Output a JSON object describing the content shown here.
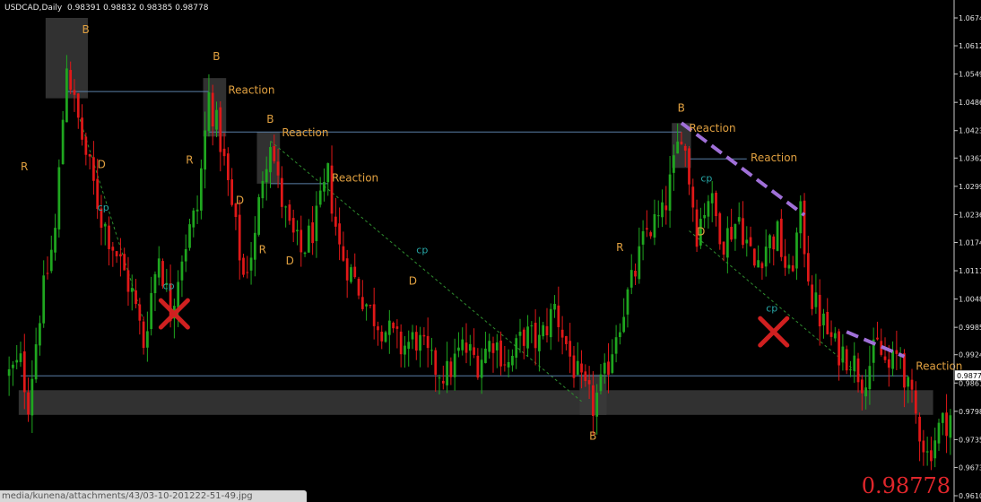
{
  "header": {
    "symbol": "USDCAD,Daily",
    "ohlc": "0.98391 0.98832 0.98385 0.98778"
  },
  "big_price": "0.98778",
  "status_url": "media/kunena/attachments/43/03-10-201222-51-49.jpg",
  "colors": {
    "background": "#000000",
    "bull": "#1fa61f",
    "bear": "#e01818",
    "annotation": "#e0a040",
    "cp_label": "#27a6a6",
    "level_line": "#5a7fa8",
    "zone": "#3a3a3a",
    "trendline": "#a070d8",
    "guide": "#2f8f2f",
    "cross": "#d02020",
    "big_price": "#e0262b"
  },
  "chart_data": {
    "type": "candlestick",
    "symbol": "USDCAD",
    "timeframe": "Daily",
    "ylim": [
      0.961,
      1.0674
    ],
    "y_tick_labels": [
      "1.0674",
      "1.0612",
      "1.0549",
      "1.0486",
      "1.0423",
      "1.0362",
      "1.0299",
      "1.0236",
      "1.0174",
      "1.0111",
      "1.0048",
      "0.9985",
      "0.9924",
      "0.9861",
      "0.9798",
      "0.9735",
      "0.9673",
      "0.9610"
    ],
    "last_price_label": "0.9877",
    "price_path": [
      [
        0,
        0.988
      ],
      [
        3,
        0.9905
      ],
      [
        5,
        0.982
      ],
      [
        8,
        1.002
      ],
      [
        12,
        1.02
      ],
      [
        15,
        1.058
      ],
      [
        17,
        1.048
      ],
      [
        20,
        1.037
      ],
      [
        24,
        1.023
      ],
      [
        28,
        1.015
      ],
      [
        32,
        1.006
      ],
      [
        35,
        0.995
      ],
      [
        37,
        1.006
      ],
      [
        39,
        1.015
      ],
      [
        42,
        1.002
      ],
      [
        45,
        1.015
      ],
      [
        49,
        1.025
      ],
      [
        52,
        1.05
      ],
      [
        55,
        1.04
      ],
      [
        58,
        1.025
      ],
      [
        61,
        1.01
      ],
      [
        64,
        1.018
      ],
      [
        66,
        1.033
      ],
      [
        68,
        1.041
      ],
      [
        70,
        1.03
      ],
      [
        73,
        1.02
      ],
      [
        76,
        1.015
      ],
      [
        80,
        1.022
      ],
      [
        83,
        1.032
      ],
      [
        86,
        1.016
      ],
      [
        90,
        1.009
      ],
      [
        94,
        1.002
      ],
      [
        98,
        0.998
      ],
      [
        102,
        0.994
      ],
      [
        106,
        0.996
      ],
      [
        110,
        0.99
      ],
      [
        114,
        0.988
      ],
      [
        118,
        0.994
      ],
      [
        122,
        0.991
      ],
      [
        126,
        0.996
      ],
      [
        130,
        0.99
      ],
      [
        134,
        0.997
      ],
      [
        138,
        0.995
      ],
      [
        142,
        1.003
      ],
      [
        146,
        0.992
      ],
      [
        149,
        0.985
      ],
      [
        152,
        0.981
      ],
      [
        155,
        0.987
      ],
      [
        158,
        0.998
      ],
      [
        162,
        1.008
      ],
      [
        166,
        1.02
      ],
      [
        170,
        1.023
      ],
      [
        173,
        1.034
      ],
      [
        175,
        1.043
      ],
      [
        177,
        1.032
      ],
      [
        179,
        1.02
      ],
      [
        182,
        1.028
      ],
      [
        186,
        1.018
      ],
      [
        190,
        1.023
      ],
      [
        194,
        1.012
      ],
      [
        197,
        1.017
      ],
      [
        200,
        1.019
      ],
      [
        203,
        1.009
      ],
      [
        206,
        1.023
      ],
      [
        209,
        1.005
      ],
      [
        212,
        0.999
      ],
      [
        215,
        0.994
      ],
      [
        219,
        0.992
      ],
      [
        222,
        0.987
      ],
      [
        226,
        0.994
      ],
      [
        229,
        0.989
      ],
      [
        232,
        0.993
      ],
      [
        234,
        0.984
      ],
      [
        237,
        0.976
      ],
      [
        239,
        0.97
      ],
      [
        242,
        0.976
      ],
      [
        245,
        0.979
      ]
    ],
    "levels": [
      {
        "from": 15,
        "to": 52,
        "price": 1.051
      },
      {
        "from": 52,
        "to": 175,
        "price": 1.042
      },
      {
        "from": 68,
        "to": 83,
        "price": 1.0305
      },
      {
        "from": 177,
        "to": 192,
        "price": 1.036
      },
      {
        "from": 155,
        "to": 234,
        "price": 0.9877
      },
      {
        "from": 3,
        "to": 155,
        "price": 0.9877
      }
    ],
    "zones": [
      {
        "from": 10,
        "to": 20,
        "high": 1.0674,
        "low": 1.0495
      },
      {
        "from": 51,
        "to": 56,
        "high": 1.054,
        "low": 1.041
      },
      {
        "from": 65,
        "to": 70,
        "high": 1.042,
        "low": 1.0305
      },
      {
        "from": 173,
        "to": 177,
        "high": 1.044,
        "low": 1.034
      },
      {
        "from": 149,
        "to": 155,
        "high": 0.988,
        "low": 0.979
      },
      {
        "from": 3,
        "to": 240,
        "high": 0.9845,
        "low": 0.979
      }
    ],
    "trendlines": [
      {
        "from": [
          175,
          1.044
        ],
        "to": [
          207,
          1.0235
        ]
      },
      {
        "from": [
          218,
          0.9975
        ],
        "to": [
          233,
          0.992
        ]
      }
    ],
    "guides": [
      {
        "from": [
          18,
          1.046
        ],
        "to": [
          35,
          1.0
        ]
      },
      {
        "from": [
          68,
          1.04
        ],
        "to": [
          149,
          0.982
        ]
      },
      {
        "from": [
          177,
          1.02
        ],
        "to": [
          222,
          0.9875
        ]
      }
    ],
    "annotations": [
      {
        "text": "B",
        "x": 19,
        "price": 1.064,
        "kind": "label"
      },
      {
        "text": "R",
        "x": 3,
        "price": 1.0335,
        "kind": "label"
      },
      {
        "text": "D",
        "x": 23,
        "price": 1.034,
        "kind": "label"
      },
      {
        "text": "cp",
        "x": 23,
        "price": 1.0245,
        "kind": "cp"
      },
      {
        "text": "cp",
        "x": 40,
        "price": 1.007,
        "kind": "cp"
      },
      {
        "text": "B",
        "x": 53,
        "price": 1.058,
        "kind": "label"
      },
      {
        "text": "Reaction",
        "x": 57,
        "price": 1.0505,
        "kind": "label"
      },
      {
        "text": "R",
        "x": 46,
        "price": 1.035,
        "kind": "label"
      },
      {
        "text": "D",
        "x": 59,
        "price": 1.026,
        "kind": "label"
      },
      {
        "text": "R",
        "x": 65,
        "price": 1.015,
        "kind": "label"
      },
      {
        "text": "B",
        "x": 67,
        "price": 1.044,
        "kind": "label"
      },
      {
        "text": "Reaction",
        "x": 71,
        "price": 1.041,
        "kind": "label"
      },
      {
        "text": "D",
        "x": 72,
        "price": 1.0125,
        "kind": "label"
      },
      {
        "text": "Reaction",
        "x": 84,
        "price": 1.031,
        "kind": "label"
      },
      {
        "text": "cp",
        "x": 106,
        "price": 1.015,
        "kind": "cp"
      },
      {
        "text": "D",
        "x": 104,
        "price": 1.008,
        "kind": "label"
      },
      {
        "text": "B",
        "x": 151,
        "price": 0.9735,
        "kind": "label"
      },
      {
        "text": "R",
        "x": 158,
        "price": 1.0155,
        "kind": "label"
      },
      {
        "text": "B",
        "x": 174,
        "price": 1.0465,
        "kind": "label"
      },
      {
        "text": "Reaction",
        "x": 177,
        "price": 1.042,
        "kind": "label"
      },
      {
        "text": "cp",
        "x": 180,
        "price": 1.031,
        "kind": "cp"
      },
      {
        "text": "Reaction",
        "x": 193,
        "price": 1.0355,
        "kind": "label"
      },
      {
        "text": "D",
        "x": 179,
        "price": 1.019,
        "kind": "label"
      },
      {
        "text": "cp",
        "x": 197,
        "price": 1.002,
        "kind": "cp"
      },
      {
        "text": "Reaction",
        "x": 236,
        "price": 0.989,
        "kind": "label"
      }
    ],
    "crosses": [
      {
        "x": 43,
        "price": 1.0015
      },
      {
        "x": 199,
        "price": 0.9975
      }
    ]
  }
}
